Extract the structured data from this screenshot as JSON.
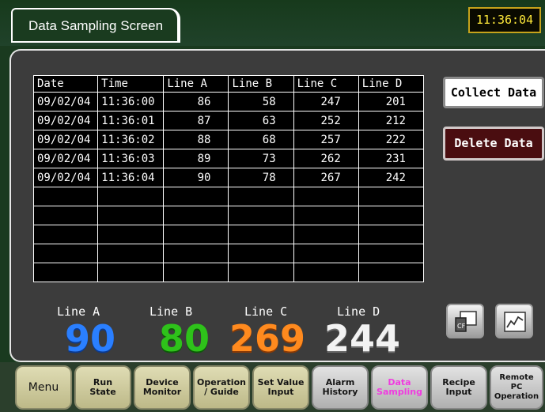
{
  "header": {
    "title": "Data Sampling Screen",
    "clock": "11:36:04"
  },
  "table": {
    "columns": [
      "Date",
      "Time",
      "Line A",
      "Line B",
      "Line C",
      "Line D"
    ],
    "rows": [
      [
        "09/02/04",
        "11:36:00",
        "86",
        "58",
        "247",
        "201"
      ],
      [
        "09/02/04",
        "11:36:01",
        "87",
        "63",
        "252",
        "212"
      ],
      [
        "09/02/04",
        "11:36:02",
        "88",
        "68",
        "257",
        "222"
      ],
      [
        "09/02/04",
        "11:36:03",
        "89",
        "73",
        "262",
        "231"
      ],
      [
        "09/02/04",
        "11:36:04",
        "90",
        "78",
        "267",
        "242"
      ]
    ],
    "empty_rows": 5
  },
  "buttons": {
    "collect": "Collect Data",
    "delete": "Delete Data"
  },
  "readouts": [
    {
      "label": "Line A",
      "value": "90",
      "color": "#2a7fff"
    },
    {
      "label": "Line B",
      "value": "80",
      "color": "#2ec21a"
    },
    {
      "label": "Line C",
      "value": "269",
      "color": "#ff8a1e"
    },
    {
      "label": "Line D",
      "value": "244",
      "color": "#f2f2f2"
    }
  ],
  "icons": {
    "left": "cf-card-icon",
    "right": "trend-graph-icon"
  },
  "nav": [
    {
      "label": "Menu",
      "style": "menu"
    },
    {
      "label": "Run\nState",
      "style": "khaki"
    },
    {
      "label": "Device\nMonitor",
      "style": "khaki"
    },
    {
      "label": "Operation\n/ Guide",
      "style": "khaki"
    },
    {
      "label": "Set Value\nInput",
      "style": "khaki"
    },
    {
      "label": "Alarm\nHistory",
      "style": "gray"
    },
    {
      "label": "Data\nSampling",
      "style": "active"
    },
    {
      "label": "Recipe\nInput",
      "style": "gray"
    },
    {
      "label": "Remote\nPC\nOperation",
      "style": "gray"
    }
  ]
}
